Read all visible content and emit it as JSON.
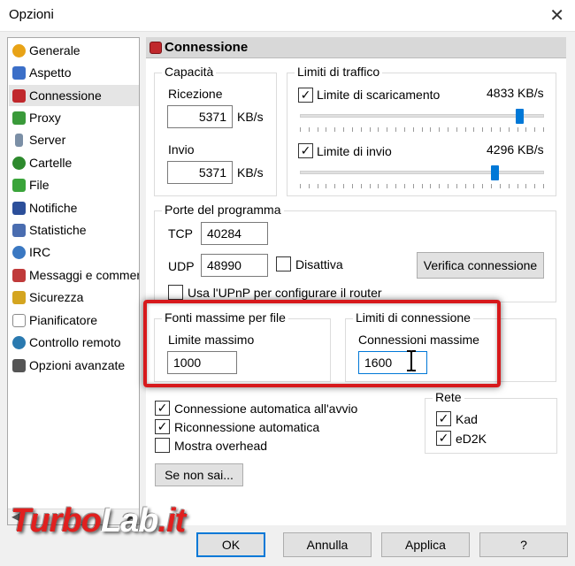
{
  "window": {
    "title": "Opzioni",
    "close": "✕"
  },
  "sidebar": {
    "items": [
      {
        "label": "Generale",
        "icon": "gear-icon",
        "color": "#e8a317"
      },
      {
        "label": "Aspetto",
        "icon": "palette-icon",
        "color": "#3b6fc8"
      },
      {
        "label": "Connessione",
        "icon": "connection-icon",
        "color": "#c0282c",
        "selected": true
      },
      {
        "label": "Proxy",
        "icon": "proxy-icon",
        "color": "#3a9a3a"
      },
      {
        "label": "Server",
        "icon": "server-icon",
        "color": "#7b8fa6"
      },
      {
        "label": "Cartelle",
        "icon": "folder-icon",
        "color": "#2d8a2d"
      },
      {
        "label": "File",
        "icon": "file-icon",
        "color": "#3aa43a"
      },
      {
        "label": "Notifiche",
        "icon": "notification-icon",
        "color": "#2c4f9a"
      },
      {
        "label": "Statistiche",
        "icon": "statistics-icon",
        "color": "#4a6db0"
      },
      {
        "label": "IRC",
        "icon": "irc-icon",
        "color": "#3a78c2"
      },
      {
        "label": "Messaggi e commenti",
        "icon": "messages-icon",
        "color": "#c03a3a"
      },
      {
        "label": "Sicurezza",
        "icon": "lock-icon",
        "color": "#d4a520"
      },
      {
        "label": "Pianificatore",
        "icon": "calendar-icon",
        "color": "#8a8a8a"
      },
      {
        "label": "Controllo remoto",
        "icon": "globe-icon",
        "color": "#2a7ab0"
      },
      {
        "label": "Opzioni avanzate",
        "icon": "advanced-icon",
        "color": "#555555"
      }
    ],
    "scroll_left": "◀",
    "scroll_right": "▶"
  },
  "panel": {
    "title": "Connessione",
    "capacity": {
      "legend": "Capacità",
      "download_label": "Ricezione",
      "download_value": "5371",
      "download_unit": "KB/s",
      "upload_label": "Invio",
      "upload_value": "5371",
      "upload_unit": "KB/s"
    },
    "limits": {
      "legend": "Limiti di traffico",
      "download_label": "Limite di scaricamento",
      "download_checked": "✓",
      "download_value": "4833 KB/s",
      "download_fraction": 0.9,
      "upload_label": "Limite di invio",
      "upload_checked": "✓",
      "upload_value": "4296 KB/s",
      "upload_fraction": 0.8
    },
    "ports": {
      "legend": "Porte del programma",
      "tcp_label": "TCP",
      "tcp_value": "40284",
      "udp_label": "UDP",
      "udp_value": "48990",
      "disable_label": "Disattiva",
      "disable_checked": "",
      "verify_button": "Verifica connessione",
      "upnp_label": "Usa l'UPnP per configurare il router",
      "upnp_checked": ""
    },
    "max_sources": {
      "legend": "Fonti massime per file",
      "label": "Limite massimo",
      "value": "1000"
    },
    "conn_limits": {
      "legend": "Limiti di connessione",
      "label": "Connessioni massime",
      "value": "1600"
    },
    "options": {
      "autoconnect_label": "Connessione automatica all'avvio",
      "autoconnect_checked": "✓",
      "reconnect_label": "Riconnessione automatica",
      "reconnect_checked": "✓",
      "overhead_label": "Mostra overhead",
      "overhead_checked": ""
    },
    "network": {
      "legend": "Rete",
      "kad_label": "Kad",
      "kad_checked": "✓",
      "ed2k_label": "eD2K",
      "ed2k_checked": "✓"
    },
    "help_button": "Se non sai..."
  },
  "footer": {
    "ok": "OK",
    "cancel": "Annulla",
    "apply": "Applica",
    "help": "?"
  },
  "watermark": {
    "part1": "Turbo",
    "part2": "Lab",
    "part3": ".it"
  },
  "colors": {
    "accent": "#0078d7",
    "highlight": "#d7191c"
  }
}
